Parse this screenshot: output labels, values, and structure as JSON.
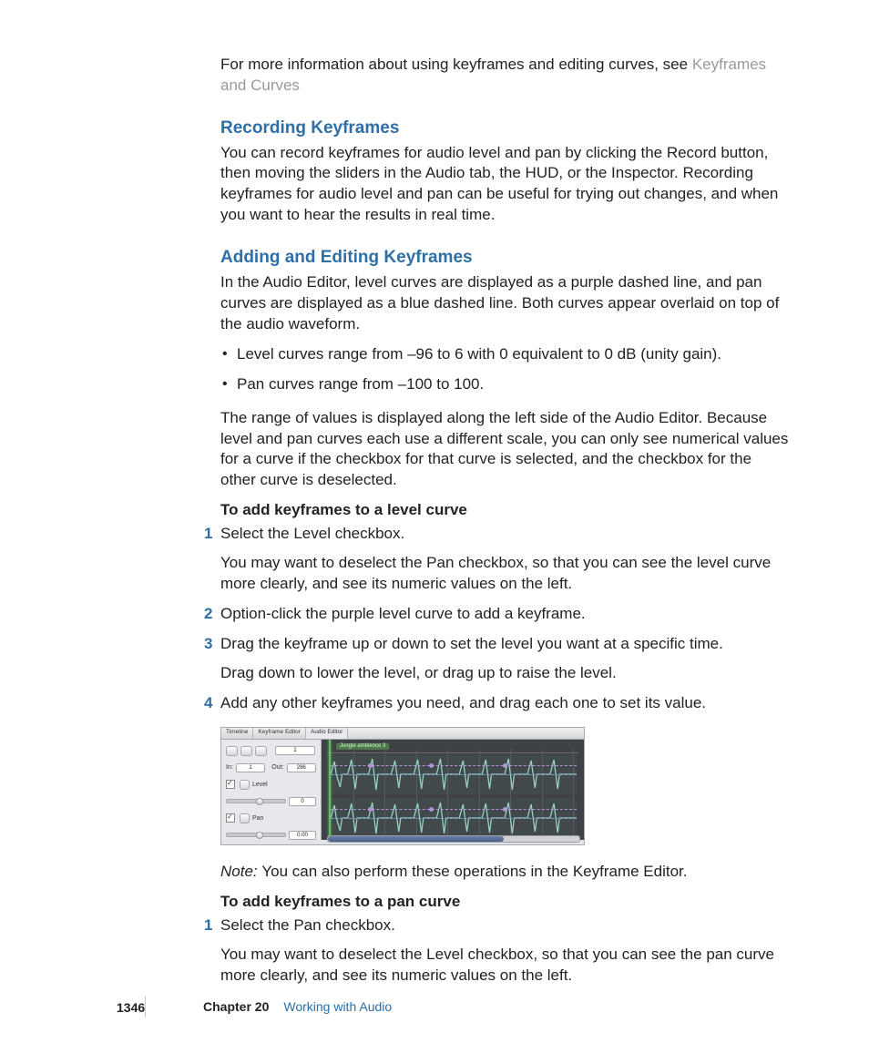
{
  "intro": {
    "text_before_link": "For more information about using keyframes and editing curves, see ",
    "link_text": "Keyframes and Curves"
  },
  "section_recording": {
    "heading": "Recording Keyframes",
    "body": "You can record keyframes for audio level and pan by clicking the Record button, then moving the sliders in the Audio tab, the HUD, or the Inspector. Recording keyframes for audio level and pan can be useful for trying out changes, and when you want to hear the results in real time."
  },
  "section_adding": {
    "heading": "Adding and Editing Keyframes",
    "body1": "In the Audio Editor, level curves are displayed as a purple dashed line, and pan curves are displayed as a blue dashed line. Both curves appear overlaid on top of the audio waveform.",
    "bullets": [
      "Level curves range from –96 to 6 with 0 equivalent to 0 dB (unity gain).",
      "Pan curves range from –100 to 100."
    ],
    "body2": "The range of values is displayed along the left side of the Audio Editor. Because level and pan curves each use a different scale, you can only see numerical values for a curve if the checkbox for that curve is selected, and the checkbox for the other curve is deselected."
  },
  "procedure_level": {
    "title": "To add keyframes to a level curve",
    "steps": [
      {
        "n": "1",
        "text": "Select the Level checkbox.",
        "sub": "You may want to deselect the Pan checkbox, so that you can see the level curve more clearly, and see its numeric values on the left."
      },
      {
        "n": "2",
        "text": "Option-click the purple level curve to add a keyframe."
      },
      {
        "n": "3",
        "text": "Drag the keyframe up or down to set the level you want at a specific time.",
        "sub": "Drag down to lower the level, or drag up to raise the level."
      },
      {
        "n": "4",
        "text": "Add any other keyframes you need, and drag each one to set its value."
      }
    ]
  },
  "figure": {
    "tabs": [
      "Timeline",
      "Keyframe Editor",
      "Audio Editor"
    ],
    "clip_name": "Jungle ambience 3",
    "in_label": "In:",
    "out_label": "Out:",
    "in_value": "1",
    "out_value": "286",
    "field_value": "1",
    "level_label": "Level",
    "level_value": "0",
    "pan_label": "Pan",
    "pan_value": "0.00"
  },
  "note": {
    "label": "Note:  ",
    "text": "You can also perform these operations in the Keyframe Editor."
  },
  "procedure_pan": {
    "title": "To add keyframes to a pan curve",
    "steps": [
      {
        "n": "1",
        "text": "Select the Pan checkbox.",
        "sub": "You may want to deselect the Level checkbox, so that you can see the pan curve more clearly, and see its numeric values on the left."
      }
    ]
  },
  "footer": {
    "page_number": "1346",
    "chapter_label": "Chapter 20",
    "chapter_title": "Working with Audio"
  }
}
